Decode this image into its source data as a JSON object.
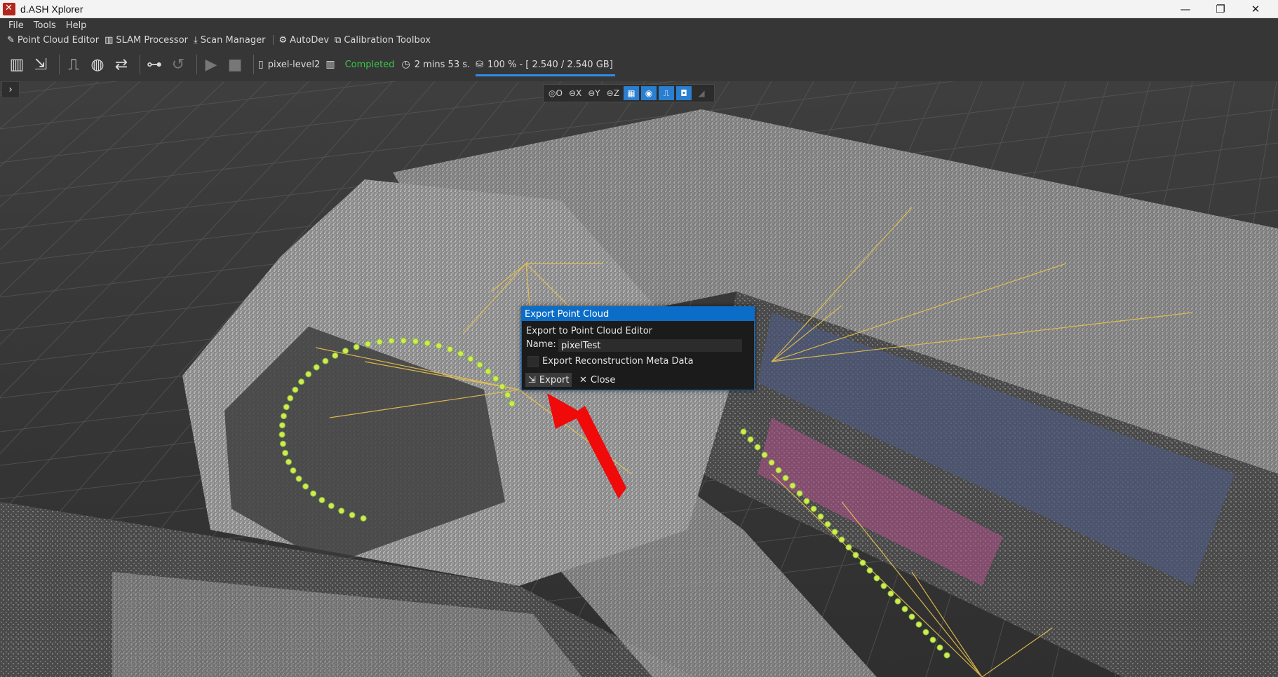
{
  "window": {
    "title": "d.ASH Xplorer",
    "icons": {
      "app": "app-logo-icon",
      "minimize": "minimize-icon",
      "restore": "restore-icon",
      "close": "close-icon"
    }
  },
  "menu": {
    "file": "File",
    "tools": "Tools",
    "help": "Help"
  },
  "modes": {
    "point_cloud_editor": "Point Cloud Editor",
    "slam_processor": "SLAM Processor",
    "scan_manager": "Scan Manager",
    "autodev": "AutoDev",
    "calibration_toolbox": "Calibration Toolbox"
  },
  "toolbar": {
    "project_name": "pixel-level2",
    "status": "Completed",
    "elapsed": "2 mins  53 s.",
    "memory": "100 % - [ 2.540 / 2.540 GB]",
    "memory_fraction": 1.0,
    "status_color": "#39c748",
    "accent_color": "#2f8de4"
  },
  "viewbar": {
    "origin": "O",
    "x": "X",
    "y": "Y",
    "z": "Z"
  },
  "dialog": {
    "title": "Export Point Cloud",
    "subtitle": "Export to Point Cloud Editor",
    "name_label": "Name:",
    "name_value": "pixelTest",
    "checkbox_label": "Export Reconstruction Meta Data",
    "checkbox_checked": false,
    "export_label": "Export",
    "close_label": "Close",
    "title_color": "#0b6dc7"
  }
}
